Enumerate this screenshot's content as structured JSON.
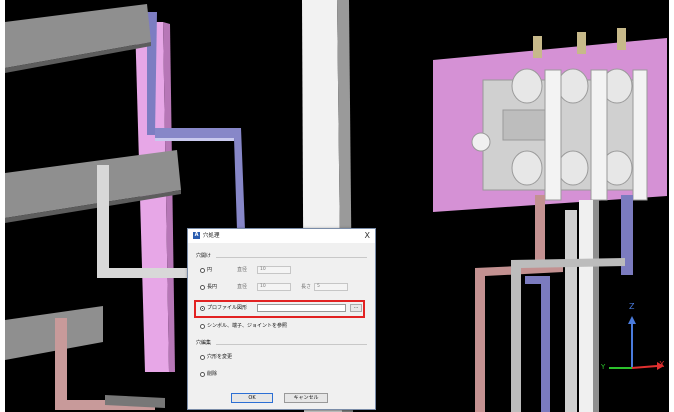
{
  "dialog": {
    "app_icon_letter": "A",
    "title": "穴処理",
    "close_glyph": "X",
    "section_hole": "穴開け",
    "options": [
      {
        "label": "円",
        "param1_label": "直径",
        "param1_value": "10",
        "selected": false
      },
      {
        "label": "長円",
        "param1_label": "直径",
        "param1_value": "10",
        "param2_label": "長さ",
        "param2_value": "5",
        "selected": false
      },
      {
        "label": "プロファイル図形",
        "path_value": "",
        "browse_label": "...",
        "selected": true
      },
      {
        "label": "シンボル、端子、ジョイントを参照",
        "selected": false
      }
    ],
    "section_edit": "穴編集",
    "edit_options": [
      {
        "label": "穴形を変更",
        "selected": false
      },
      {
        "label": "削除",
        "selected": false
      }
    ],
    "ok_label": "OK",
    "cancel_label": "キャンセル"
  },
  "viewport": {
    "background": "#000000",
    "axes": {
      "z_label": "Z",
      "y_label": "Y",
      "x_label": "X"
    },
    "colors": {
      "bar_gray": "#8e8e8e",
      "plate_pink": "#d591d5",
      "blue_bar": "#7b7bbf",
      "copper": "#b88686",
      "highlight_red": "#e22222"
    }
  }
}
